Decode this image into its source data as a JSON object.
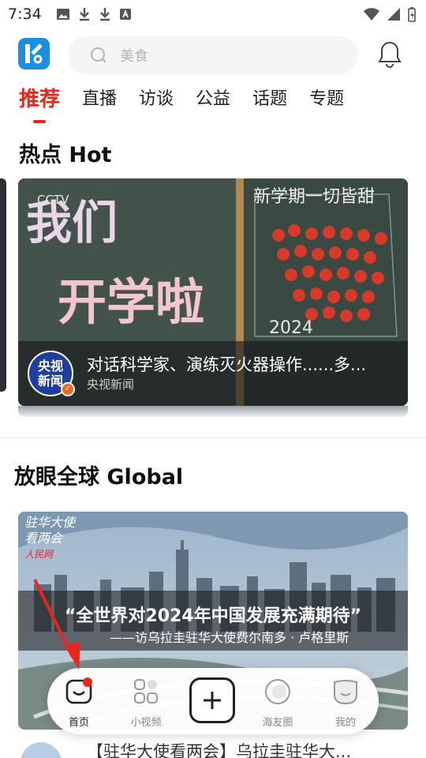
{
  "status_bar": {
    "time": "7:34"
  },
  "header": {
    "search_placeholder": "美食"
  },
  "tabs": [
    {
      "label": "推荐",
      "active": true
    },
    {
      "label": "直播"
    },
    {
      "label": "访谈"
    },
    {
      "label": "公益"
    },
    {
      "label": "话题"
    },
    {
      "label": "专题"
    }
  ],
  "hot_section": {
    "title": "热点 Hot",
    "card": {
      "title": "对话科学家、演练灭火器操作......多...",
      "source": "央视新闻",
      "avatar_text_line1": "央视",
      "avatar_text_line2": "新闻",
      "image_text_1": "我们",
      "image_text_2": "开学啦",
      "image_text_3": "新学期一切皆甜",
      "image_text_4": "2024",
      "image_logo": "CCTV"
    }
  },
  "global_section": {
    "title": "放眼全球 Global",
    "card": {
      "brand_line1": "驻华大使",
      "brand_line2": "看两会",
      "brand_line3": "人民网",
      "headline": "“全世界对2024年中国发展充满期待”",
      "subheadline": "——访乌拉圭驻华大使费尔南多 · 卢格里斯"
    },
    "next_item_title": "【驻华大使看两会】乌拉圭驻华大..."
  },
  "bottom_nav": {
    "items": [
      {
        "label": "首页",
        "active": true
      },
      {
        "label": "小视频"
      },
      {
        "label": "海友圈"
      },
      {
        "label": "我的"
      }
    ]
  },
  "colors": {
    "accent": "#e8261e",
    "logo_blue": "#1a8fe0"
  }
}
